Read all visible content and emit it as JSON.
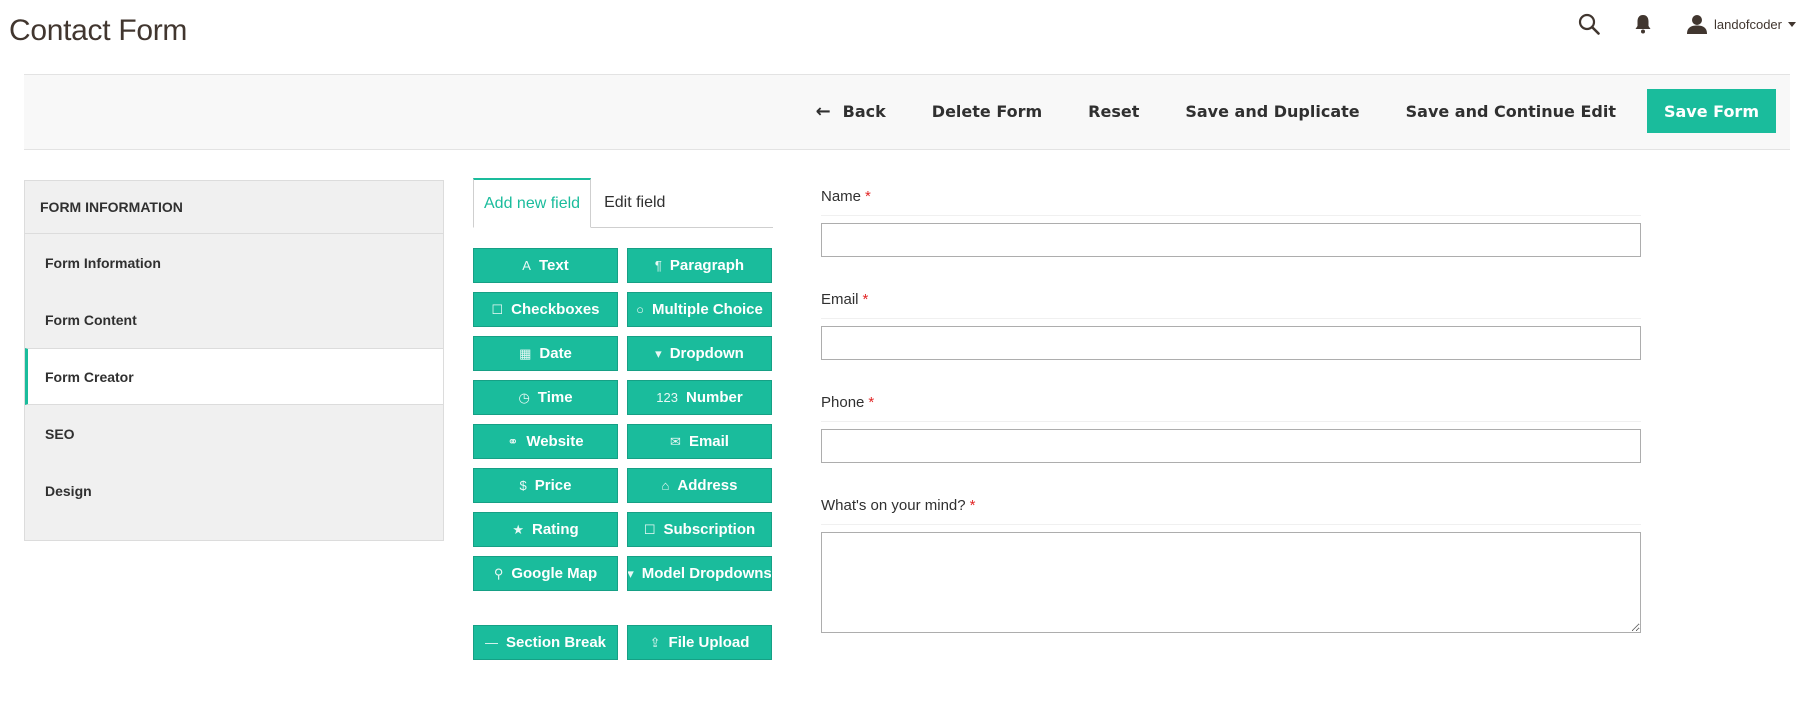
{
  "header": {
    "title": "Contact Form",
    "search_icon": "search-icon",
    "notifications_icon": "bell-icon",
    "user": {
      "icon": "user-icon",
      "name": "landofcoder"
    }
  },
  "toolbar": {
    "back_label": "Back",
    "delete_label": "Delete Form",
    "reset_label": "Reset",
    "save_duplicate_label": "Save and Duplicate",
    "save_continue_label": "Save and Continue Edit",
    "save_label": "Save Form"
  },
  "sidebar": {
    "heading": "FORM INFORMATION",
    "items": [
      {
        "label": "Form Information",
        "active": false
      },
      {
        "label": "Form Content",
        "active": false
      },
      {
        "label": "Form Creator",
        "active": true
      },
      {
        "label": "SEO",
        "active": false
      },
      {
        "label": "Design",
        "active": false
      }
    ]
  },
  "builder": {
    "tabs": [
      {
        "label": "Add new field",
        "active": true
      },
      {
        "label": "Edit field",
        "active": false
      }
    ],
    "fields": [
      {
        "label": "Text",
        "icon": "text-icon",
        "glyph": "A"
      },
      {
        "label": "Paragraph",
        "icon": "paragraph-icon",
        "glyph": "¶"
      },
      {
        "label": "Checkboxes",
        "icon": "checkbox-icon",
        "glyph": "☐"
      },
      {
        "label": "Multiple Choice",
        "icon": "radio-icon",
        "glyph": "○"
      },
      {
        "label": "Date",
        "icon": "calendar-icon",
        "glyph": "▦"
      },
      {
        "label": "Dropdown",
        "icon": "dropdown-icon",
        "glyph": "▾"
      },
      {
        "label": "Time",
        "icon": "clock-icon",
        "glyph": "◷"
      },
      {
        "label": "Number",
        "icon": "number-icon",
        "glyph": "123"
      },
      {
        "label": "Website",
        "icon": "link-icon",
        "glyph": "⚭"
      },
      {
        "label": "Email",
        "icon": "envelope-icon",
        "glyph": "✉"
      },
      {
        "label": "Price",
        "icon": "dollar-icon",
        "glyph": "$"
      },
      {
        "label": "Address",
        "icon": "home-icon",
        "glyph": "⌂"
      },
      {
        "label": "Rating",
        "icon": "star-icon",
        "glyph": "★"
      },
      {
        "label": "Subscription",
        "icon": "checkbox-icon",
        "glyph": "☐"
      },
      {
        "label": "Google Map",
        "icon": "map-marker-icon",
        "glyph": "⚲"
      },
      {
        "label": "Model Dropdowns",
        "icon": "dropdown-icon",
        "glyph": "▾"
      }
    ],
    "extra_fields": [
      {
        "label": "Section Break",
        "icon": "minus-icon",
        "glyph": "—"
      },
      {
        "label": "File Upload",
        "icon": "upload-icon",
        "glyph": "⇪"
      }
    ]
  },
  "form": {
    "required_mark": "*",
    "fields": [
      {
        "label": "Name",
        "type": "input",
        "value": ""
      },
      {
        "label": "Email",
        "type": "input",
        "value": ""
      },
      {
        "label": "Phone",
        "type": "input",
        "value": ""
      },
      {
        "label": "What's on your mind?",
        "type": "textarea",
        "value": ""
      }
    ]
  },
  "colors": {
    "accent": "#1abc9c",
    "required": "#e22626",
    "text": "#303030"
  }
}
